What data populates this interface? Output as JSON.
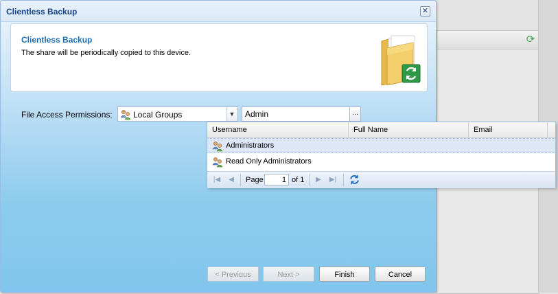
{
  "dialog": {
    "title": "Clientless Backup",
    "header_title": "Clientless Backup",
    "header_description": "The share will be periodically copied to this device."
  },
  "permissions": {
    "label": "File Access Permissions:",
    "combo_value": "Local Groups",
    "search_value": "Admin",
    "browse_label": "..."
  },
  "grid": {
    "columns": [
      "Username",
      "Full Name",
      "Email"
    ],
    "rows": [
      {
        "username": "Administrators",
        "full_name": "",
        "email": "",
        "selected": true
      },
      {
        "username": "Read Only Administrators",
        "full_name": "",
        "email": "",
        "selected": false
      }
    ],
    "pager": {
      "page_label": "Page",
      "page_value": "1",
      "of_label": "of 1"
    }
  },
  "buttons": {
    "previous": "< Previous",
    "next": "Next >",
    "finish": "Finish",
    "cancel": "Cancel"
  },
  "icons": {
    "close": "close-icon",
    "group": "user-group-icon",
    "refresh": "refresh-icon",
    "folder": "folder-sync-icon"
  },
  "colors": {
    "accent": "#15428b",
    "header_title": "#1a6fb5",
    "selection": "#dde7f5"
  }
}
